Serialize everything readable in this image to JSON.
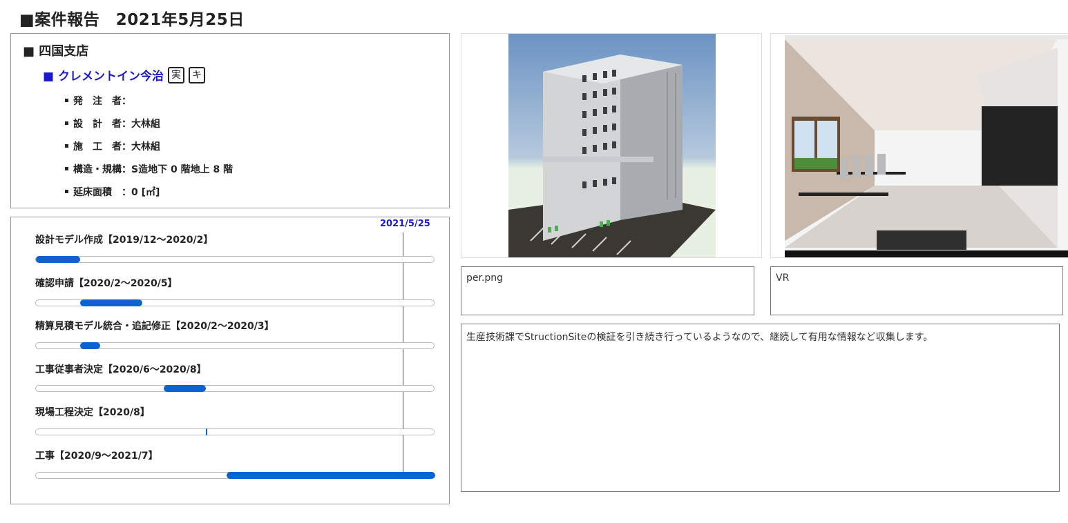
{
  "header": {
    "title": "■案件報告　2021年5月25日"
  },
  "info": {
    "branch": "■ 四国支店",
    "project_name": "■ クレメントイン今治",
    "badges": [
      "実",
      "キ"
    ],
    "details": [
      "発　注　者：",
      "設　計　者：大林組",
      "施　工　者：大林組",
      "構造・規構：S造地下 0 階地上 8 階",
      "延床面積　：0 [㎡]"
    ]
  },
  "schedule": {
    "today_label": "2021/5/25",
    "accent_color": "#0b63d3",
    "today_color": "#cc1111",
    "tasks": [
      {
        "label": "設計モデル作成【2019/12～2020/2】",
        "start": 0.0,
        "end": 0.11
      },
      {
        "label": "確認申請【2020/2～2020/5】",
        "start": 0.11,
        "end": 0.265
      },
      {
        "label": "精算見積モデル統合・追記修正【2020/2～2020/3】",
        "start": 0.11,
        "end": 0.16
      },
      {
        "label": "工事従事者決定【2020/6～2020/8】",
        "start": 0.32,
        "end": 0.425
      },
      {
        "label": "現場工程決定【2020/8】",
        "start": 0.425,
        "end": 0.428
      },
      {
        "label": "工事【2020/9～2021/7】",
        "start": 0.478,
        "end": 1.0
      }
    ]
  },
  "images": [
    {
      "name": "building-render-image",
      "caption": "per.png"
    },
    {
      "name": "vr-interior-screenshot",
      "caption": "VR"
    }
  ],
  "note": "生産技術課でStructionSiteの検証を引き続き行っているようなので、継続して有用な情報など収集します。"
}
